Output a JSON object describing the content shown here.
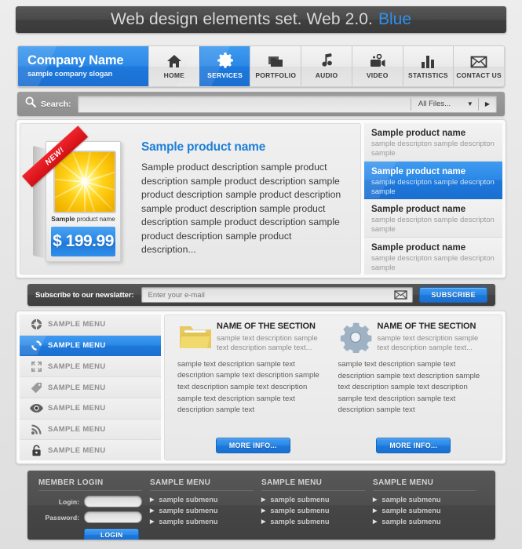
{
  "title_bar": {
    "text": "Web design elements set. Web 2.0.",
    "accent_text": "Blue",
    "accent_color": "#2f90ee"
  },
  "nav": {
    "brand": {
      "name": "Company Name",
      "slogan": "sample company slogan"
    },
    "items": [
      {
        "label": "HOME",
        "icon": "home-icon",
        "active": false
      },
      {
        "label": "SERVICES",
        "icon": "gear-icon",
        "active": true
      },
      {
        "label": "PORTFOLIO",
        "icon": "folder-icon",
        "active": false
      },
      {
        "label": "AUDIO",
        "icon": "music-note-icon",
        "active": false
      },
      {
        "label": "VIDEO",
        "icon": "video-camera-icon",
        "active": false
      },
      {
        "label": "STATISTICS",
        "icon": "bar-chart-icon",
        "active": false
      },
      {
        "label": "CONTACT US",
        "icon": "envelope-icon",
        "active": false
      }
    ]
  },
  "search": {
    "label": "Search:",
    "value": "",
    "placeholder": "",
    "filter_value": "All Files...",
    "dropdown_arrow": "▼",
    "go_arrow": "▶"
  },
  "showcase": {
    "box": {
      "ribbon": "NEW!",
      "caption_bold": "Sample",
      "caption_rest": " product name",
      "price": "$ 199.99"
    },
    "heading": "Sample product name",
    "description": "Sample product description sample product description sample product description sample product description sample product description sample product description sample product description sample product description sample product description sample product description...",
    "list": [
      {
        "title": "Sample product name",
        "desc": "sample descripton sample descripton sample",
        "active": false
      },
      {
        "title": "Sample product name",
        "desc": "sample descripton sample descripton sample",
        "active": true
      },
      {
        "title": "Sample product name",
        "desc": "sample descripton sample descripton sample",
        "active": false
      },
      {
        "title": "Sample product name",
        "desc": "sample descripton sample descripton sample",
        "active": false
      }
    ]
  },
  "newsletter": {
    "label": "Subscribe to our newslatter:",
    "value": "",
    "placeholder": "Enter your e-mail",
    "icon": "envelope-icon",
    "button": "SUBSCRIBE"
  },
  "sidebar": {
    "items": [
      {
        "label": "SAMPLE MENU",
        "icon": "globe-icon",
        "active": false
      },
      {
        "label": "SAMPLE MENU",
        "icon": "refresh-icon",
        "active": true
      },
      {
        "label": "SAMPLE MENU",
        "icon": "expand-icon",
        "active": false
      },
      {
        "label": "SAMPLE MENU",
        "icon": "tag-icon",
        "active": false
      },
      {
        "label": "SAMPLE MENU",
        "icon": "eye-icon",
        "active": false
      },
      {
        "label": "SAMPLE MENU",
        "icon": "rss-icon",
        "active": false
      },
      {
        "label": "SAMPLE MENU",
        "icon": "lock-icon",
        "active": false
      }
    ]
  },
  "sections": [
    {
      "icon": "folder-icon",
      "heading": "NAME OF THE SECTION",
      "subtext": "sample text description sample text description sample text...",
      "body": "sample text description sample text description sample text description sample text description sample text description sample text description sample text description sample text",
      "button": "MORE INFO..."
    },
    {
      "icon": "gear-icon",
      "heading": "NAME OF THE SECTION",
      "subtext": "sample text description sample text description sample text...",
      "body": "sample text description sample text description sample text description sample text description sample text description sample text description sample text description sample text",
      "button": "MORE INFO..."
    }
  ],
  "footer": {
    "login": {
      "heading": "MEMBER LOGIN",
      "login_label": "Login:",
      "login_value": "",
      "password_label": "Password:",
      "password_value": "",
      "button": "LOGIN"
    },
    "menus": [
      {
        "heading": "SAMPLE MENU",
        "items": [
          "sample submenu",
          "sample submenu",
          "sample submenu"
        ]
      },
      {
        "heading": "SAMPLE MENU",
        "items": [
          "sample submenu",
          "sample submenu",
          "sample submenu"
        ]
      },
      {
        "heading": "SAMPLE MENU",
        "items": [
          "sample submenu",
          "sample submenu",
          "sample submenu"
        ]
      }
    ],
    "arrow": "▶"
  }
}
